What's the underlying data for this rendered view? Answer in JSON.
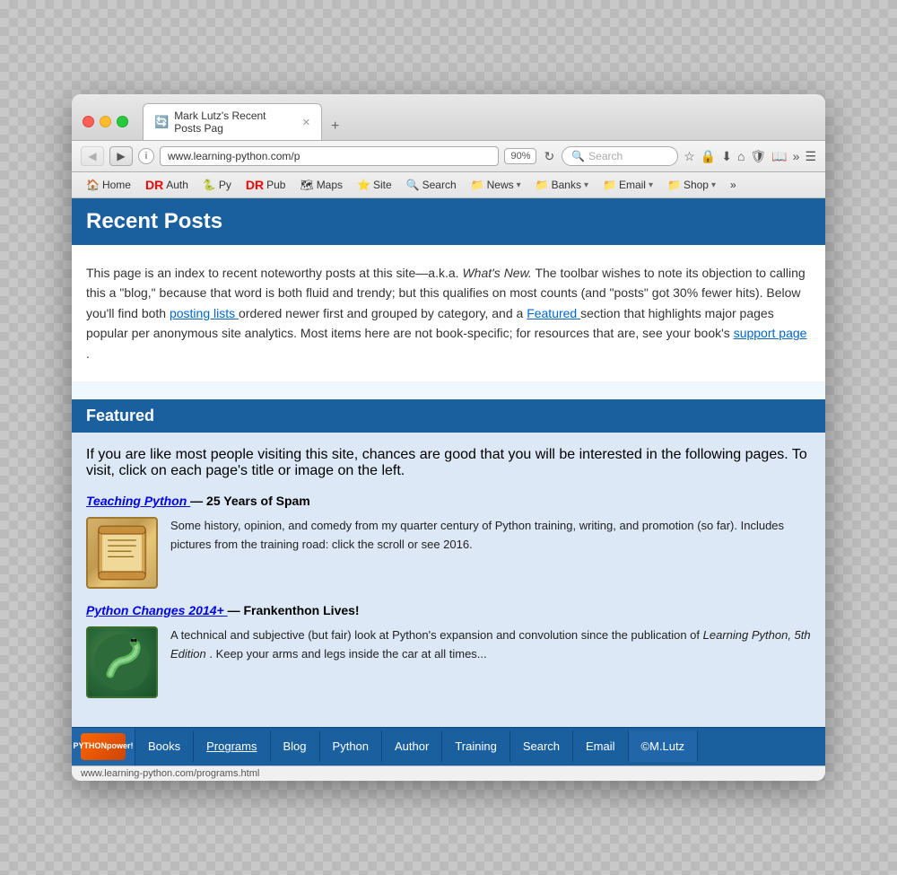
{
  "browser": {
    "title": "Mark Lutz's Recent Posts Pag",
    "url": "www.learning-python.com/p",
    "zoom": "90%",
    "search_placeholder": "Search",
    "new_tab_label": "+"
  },
  "bookmarks": {
    "items": [
      {
        "label": "Home",
        "icon": "🏠",
        "dropdown": false
      },
      {
        "label": "Auth",
        "icon": "🔴",
        "dropdown": false
      },
      {
        "label": "Py",
        "icon": "🐍",
        "dropdown": false
      },
      {
        "label": "Pub",
        "icon": "🔴",
        "dropdown": false
      },
      {
        "label": "Maps",
        "icon": "🗺",
        "dropdown": false
      },
      {
        "label": "Site",
        "icon": "⭐",
        "dropdown": false
      },
      {
        "label": "Search",
        "icon": "🔍",
        "dropdown": false
      },
      {
        "label": "News",
        "icon": "📁",
        "dropdown": true
      },
      {
        "label": "Banks",
        "icon": "📁",
        "dropdown": true
      },
      {
        "label": "Email",
        "icon": "📁",
        "dropdown": true
      },
      {
        "label": "Shop",
        "icon": "📁",
        "dropdown": true
      },
      {
        "label": "»",
        "icon": "",
        "dropdown": false
      }
    ]
  },
  "page": {
    "header": "Recent Posts",
    "intro_text_1": "This page is an index to recent noteworthy posts at this site—a.k.a.",
    "intro_italic": "What's New.",
    "intro_text_2": "The toolbar wishes to note its objection to calling this a \"blog,\" because that word is both fluid and trendy; but this qualifies on most counts (and \"posts\" got 30% fewer hits). Below you'll find both",
    "intro_link_1": "posting lists",
    "intro_text_3": "ordered newer first and grouped by category, and a",
    "intro_link_2": "Featured",
    "intro_text_4": "section that highlights major pages popular per anonymous site analytics. Most items here are not book-specific; for resources that are, see your book's",
    "intro_link_3": "support page",
    "intro_text_5": ".",
    "featured_header": "Featured",
    "featured_intro": "If you are like most people visiting this site, chances are good that you will be interested in the following pages. To visit, click on each page's title or image on the left.",
    "item1": {
      "title": "Teaching Python",
      "title_sep": " — 25 Years of Spam",
      "desc": "Some history, opinion, and comedy from my quarter century of Python training, writing, and promotion (so far). Includes pictures from the training road: click the scroll or see 2016."
    },
    "item2": {
      "title": "Python Changes 2014+",
      "title_sep": " — Frankenthon Lives!",
      "desc_before": "A technical and subjective (but fair) look at Python's expansion and convolution since the publication of",
      "desc_italic": "Learning Python, 5th Edition",
      "desc_after": ". Keep your arms and legs inside the car at all times..."
    }
  },
  "footer": {
    "logo_line1": "PYTHON",
    "logo_line2": "power!",
    "nav_items": [
      {
        "label": "Books",
        "active": false
      },
      {
        "label": "Programs",
        "active": true
      },
      {
        "label": "Blog",
        "active": false
      },
      {
        "label": "Python",
        "active": false
      },
      {
        "label": "Author",
        "active": false
      },
      {
        "label": "Training",
        "active": false
      },
      {
        "label": "Search",
        "active": false
      },
      {
        "label": "Email",
        "active": false
      },
      {
        "label": "©M.Lutz",
        "active": false,
        "copyright": true
      }
    ]
  },
  "status_bar": {
    "text": "www.learning-python.com/programs.html"
  }
}
